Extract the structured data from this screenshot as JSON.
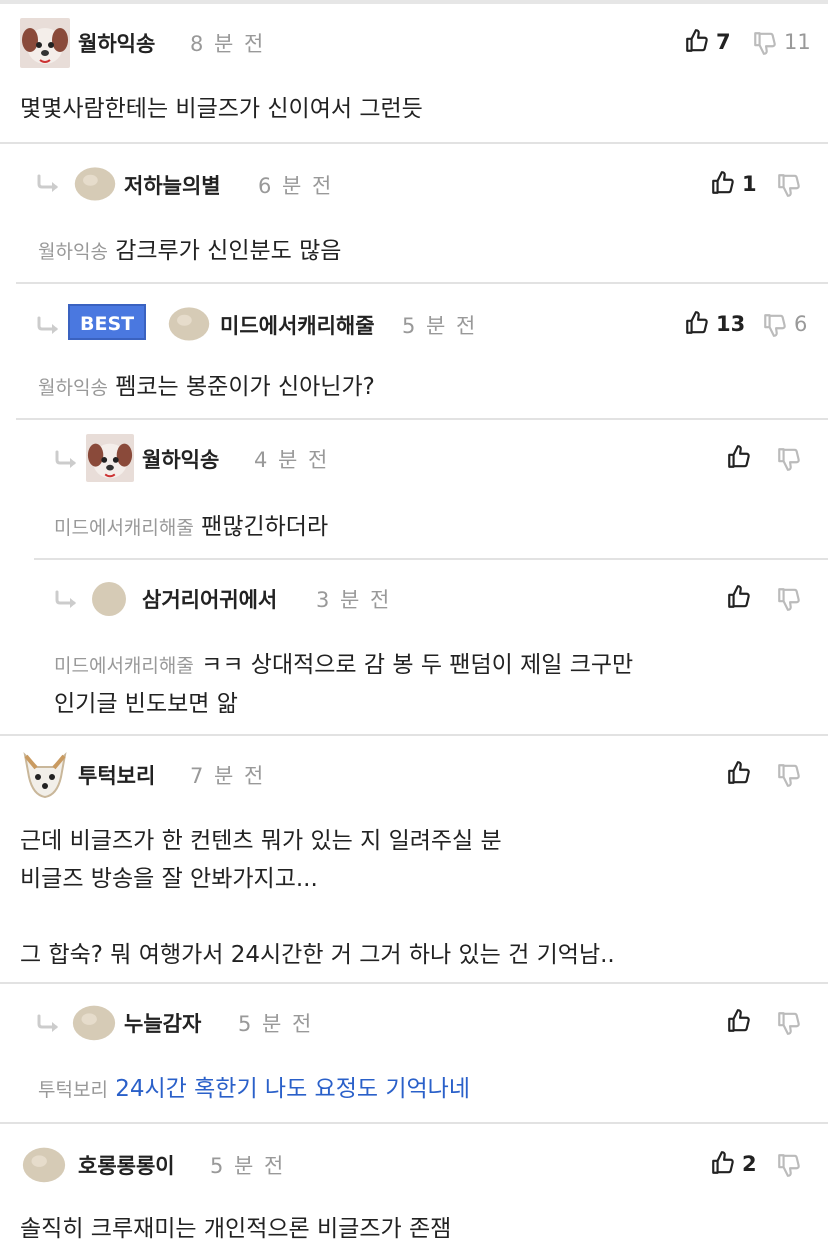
{
  "comments": [
    {
      "author": "월하익송",
      "time": "8 분 전",
      "likes": "7",
      "dislikes": "11",
      "text": "몇몇사람한테는 비글즈가 신이여서 그런듯"
    },
    {
      "author": "저하늘의별",
      "time": "6 분 전",
      "likes": "1",
      "dislikes": "",
      "mention": "월하익송",
      "text": "감크루가 신인분도 많음"
    },
    {
      "author": "미드에서캐리해줄",
      "time": "5 분 전",
      "badge": "BEST",
      "likes": "13",
      "dislikes": "6",
      "mention": "월하익송",
      "text": "펨코는 봉준이가 신아닌가?"
    },
    {
      "author": "월하익송",
      "time": "4 분 전",
      "likes": "",
      "dislikes": "",
      "mention": "미드에서캐리해줄",
      "text": "팬많긴하더라"
    },
    {
      "author": "삼거리어귀에서",
      "time": "3 분 전",
      "likes": "",
      "dislikes": "",
      "mention": "미드에서캐리해줄",
      "text_line1": "ㅋㅋ 상대적으로 감 봉 두 팬덤이 제일 크구만",
      "text_line2": "인기글 빈도보면 앎"
    },
    {
      "author": "투턱보리",
      "time": "7 분 전",
      "likes": "",
      "dislikes": "",
      "text_line1": "근데 비글즈가 한 컨텐츠 뭐가 있는 지 일려주실 분",
      "text_line2": "비글즈 방송을 잘 안봐가지고...",
      "text_line3": "그 합숙? 뭐 여행가서 24시간한 거 그거 하나 있는 건 기억남.."
    },
    {
      "author": "누늘감자",
      "time": "5 분 전",
      "likes": "",
      "dislikes": "",
      "mention": "투턱보리",
      "text": "24시간 혹한기 나도 요정도 기억나네"
    },
    {
      "author": "호롱롱롱이",
      "time": "5 분 전",
      "likes": "2",
      "dislikes": "",
      "text": "솔직히 크루재미는 개인적으론 비글즈가 존잼"
    }
  ],
  "colors": {
    "accent": "#4a78e0",
    "link": "#2a60c9",
    "muted": "#999999",
    "divider": "#e2e2e2"
  }
}
